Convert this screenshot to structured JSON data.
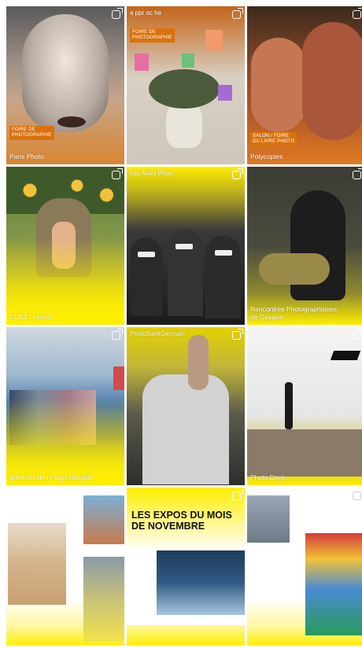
{
  "tiles": [
    {
      "badge": "FOIRE DE\nPHOTOGRAPHIE",
      "caption": "Paris Photo"
    },
    {
      "badge": "FOIRE DE\nPHOTOGRAPHIE",
      "top_caption": "a ppr oc he"
    },
    {
      "badge": "SALON / FOIRE\nDU LIVRE PHOTO",
      "caption": "Polycopies"
    },
    {
      "caption": "GLAZ Festival"
    },
    {
      "top_caption": "Les Nuits Photo"
    },
    {
      "caption": "Rencontres Photographiques\nde Guyane"
    },
    {
      "caption": "Biennale de l'image tangible"
    },
    {
      "top_caption": "PhotoSaintGermain"
    },
    {
      "caption": "Photo Days"
    }
  ],
  "title_card": {
    "heading": "LES EXPOS DU MOIS\nDE NOVEMBRE"
  },
  "colors": {
    "accent_yellow": "#ffee00",
    "badge_orange": "#d9720c"
  },
  "icons": {
    "multi": "multiple-images-icon"
  }
}
